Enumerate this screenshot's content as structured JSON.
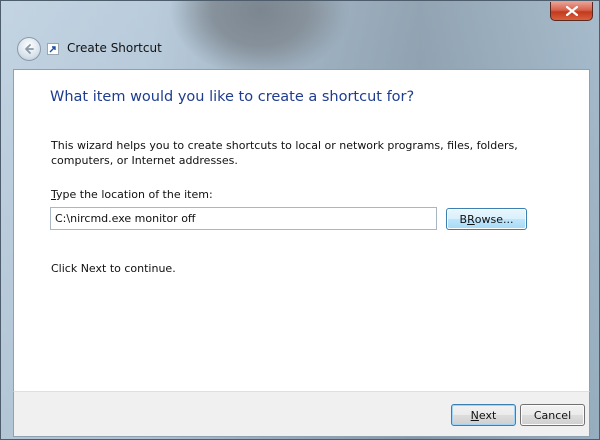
{
  "window": {
    "title": "Create Shortcut"
  },
  "nav": {
    "back_icon": "back-arrow-icon",
    "wizard_icon": "shortcut-icon"
  },
  "main": {
    "heading": "What item would you like to create a shortcut for?",
    "description": "This wizard helps you to create shortcuts to local or network programs, files, folders, computers, or Internet addresses.",
    "location_label_accel": "T",
    "location_label_rest": "ype the location of the item:",
    "location_value": "C:\\nircmd.exe monitor off",
    "browse_accel": "R",
    "browse_prefix": "B",
    "browse_rest": "owse...",
    "continue_text": "Click Next to continue."
  },
  "footer": {
    "next_accel": "N",
    "next_rest": "ext",
    "cancel_label": "Cancel"
  },
  "colors": {
    "heading": "#1e3d8f",
    "close_button": "#c2391f"
  }
}
